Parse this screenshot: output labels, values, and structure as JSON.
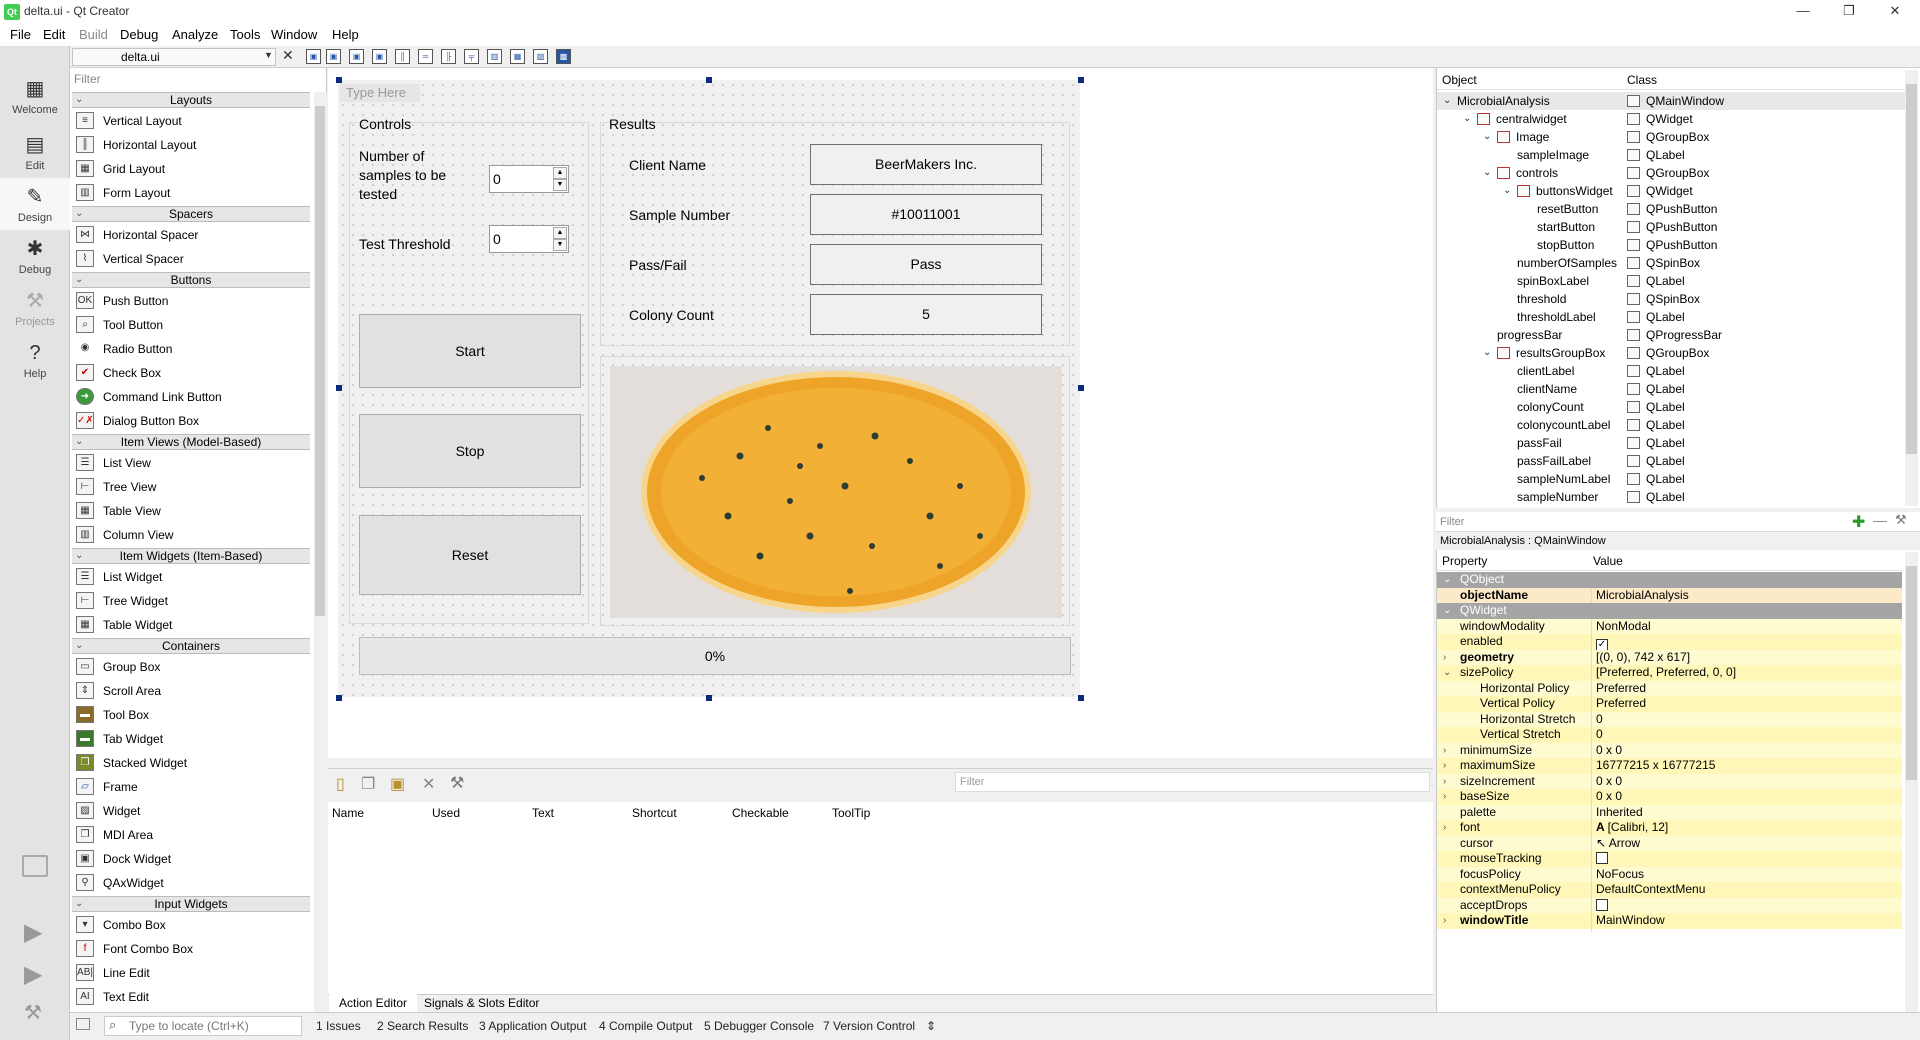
{
  "window": {
    "title": "delta.ui - Qt Creator",
    "logo": "qt",
    "min": "—",
    "restore": "❐",
    "close": "✕"
  },
  "menu": [
    "File",
    "Edit",
    "Build",
    "Debug",
    "Analyze",
    "Tools",
    "Window",
    "Help"
  ],
  "modes": [
    {
      "label": "Welcome",
      "icon": "grid-icon"
    },
    {
      "label": "Edit",
      "icon": "document-icon"
    },
    {
      "label": "Design",
      "icon": "pencil-icon"
    },
    {
      "label": "Debug",
      "icon": "bug-icon"
    },
    {
      "label": "Projects",
      "icon": "wrench-icon"
    },
    {
      "label": "Help",
      "icon": "help-icon"
    }
  ],
  "file_combo": {
    "value": "delta.ui"
  },
  "widget_box": {
    "filter_placeholder": "Filter",
    "categories": [
      "Layouts",
      "Spacers",
      "Buttons",
      "Item Views (Model-Based)",
      "Item Widgets (Item-Based)",
      "Containers",
      "Input Widgets"
    ],
    "items": [
      "Vertical Layout",
      "Horizontal Layout",
      "Grid Layout",
      "Form Layout",
      "Horizontal Spacer",
      "Vertical Spacer",
      "Push Button",
      "Tool Button",
      "Radio Button",
      "Check Box",
      "Command Link Button",
      "Dialog Button Box",
      "List View",
      "Tree View",
      "Table View",
      "Column View",
      "List Widget",
      "Tree Widget",
      "Table Widget",
      "Group Box",
      "Scroll Area",
      "Tool Box",
      "Tab Widget",
      "Stacked Widget",
      "Frame",
      "Widget",
      "MDI Area",
      "Dock Widget",
      "QAxWidget",
      "Combo Box",
      "Font Combo Box",
      "Line Edit",
      "Text Edit"
    ]
  },
  "form": {
    "type_here": "Type Here",
    "controls_title": "Controls",
    "samples_label": "Number of samples to be tested",
    "samples_value": "0",
    "threshold_label": "Test Threshold",
    "threshold_value": "0",
    "start": "Start",
    "stop": "Stop",
    "reset": "Reset",
    "results_title": "Results",
    "client_label": "Client Name",
    "client_value": "BeerMakers Inc.",
    "sample_label": "Sample Number",
    "sample_value": "#10011001",
    "passfail_label": "Pass/Fail",
    "passfail_value": "Pass",
    "colony_label": "Colony Count",
    "colony_value": "5",
    "progress": "0%",
    "progress_fraction": 0
  },
  "action_editor": {
    "filter_placeholder": "Filter",
    "columns": [
      "Name",
      "Used",
      "Text",
      "Shortcut",
      "Checkable",
      "ToolTip"
    ],
    "tabs": [
      "Action Editor",
      "Signals & Slots Editor"
    ]
  },
  "object_inspector": {
    "headers": [
      "Object",
      "Class"
    ],
    "rows": [
      {
        "name": "MicrobialAnalysis",
        "cls": "QMainWindow"
      },
      {
        "name": "centralwidget",
        "cls": "QWidget"
      },
      {
        "name": "Image",
        "cls": "QGroupBox"
      },
      {
        "name": "sampleImage",
        "cls": "QLabel"
      },
      {
        "name": "controls",
        "cls": "QGroupBox"
      },
      {
        "name": "buttonsWidget",
        "cls": "QWidget"
      },
      {
        "name": "resetButton",
        "cls": "QPushButton"
      },
      {
        "name": "startButton",
        "cls": "QPushButton"
      },
      {
        "name": "stopButton",
        "cls": "QPushButton"
      },
      {
        "name": "numberOfSamples",
        "cls": "QSpinBox"
      },
      {
        "name": "spinBoxLabel",
        "cls": "QLabel"
      },
      {
        "name": "threshold",
        "cls": "QSpinBox"
      },
      {
        "name": "thresholdLabel",
        "cls": "QLabel"
      },
      {
        "name": "progressBar",
        "cls": "QProgressBar"
      },
      {
        "name": "resultsGroupBox",
        "cls": "QGroupBox"
      },
      {
        "name": "clientLabel",
        "cls": "QLabel"
      },
      {
        "name": "clientName",
        "cls": "QLabel"
      },
      {
        "name": "colonyCount",
        "cls": "QLabel"
      },
      {
        "name": "colonycountLabel",
        "cls": "QLabel"
      },
      {
        "name": "passFail",
        "cls": "QLabel"
      },
      {
        "name": "passFailLabel",
        "cls": "QLabel"
      },
      {
        "name": "sampleNumLabel",
        "cls": "QLabel"
      },
      {
        "name": "sampleNumber",
        "cls": "QLabel"
      }
    ]
  },
  "property_editor": {
    "filter_placeholder": "Filter",
    "title": "MicrobialAnalysis : QMainWindow",
    "headers": [
      "Property",
      "Value"
    ],
    "rows": [
      {
        "name": "QObject",
        "value": ""
      },
      {
        "name": "objectName",
        "value": "MicrobialAnalysis"
      },
      {
        "name": "QWidget",
        "value": ""
      },
      {
        "name": "windowModality",
        "value": "NonModal"
      },
      {
        "name": "enabled",
        "value": "✓"
      },
      {
        "name": "geometry",
        "value": "[(0, 0), 742 x 617]"
      },
      {
        "name": "sizePolicy",
        "value": "[Preferred, Preferred, 0, 0]"
      },
      {
        "name": "Horizontal Policy",
        "value": "Preferred"
      },
      {
        "name": "Vertical Policy",
        "value": "Preferred"
      },
      {
        "name": "Horizontal Stretch",
        "value": "0"
      },
      {
        "name": "Vertical Stretch",
        "value": "0"
      },
      {
        "name": "minimumSize",
        "value": "0 x 0"
      },
      {
        "name": "maximumSize",
        "value": "16777215 x 16777215"
      },
      {
        "name": "sizeIncrement",
        "value": "0 x 0"
      },
      {
        "name": "baseSize",
        "value": "0 x 0"
      },
      {
        "name": "palette",
        "value": "Inherited"
      },
      {
        "name": "font",
        "value": "[Calibri, 12]"
      },
      {
        "name": "cursor",
        "value": "Arrow"
      },
      {
        "name": "mouseTracking",
        "value": ""
      },
      {
        "name": "focusPolicy",
        "value": "NoFocus"
      },
      {
        "name": "contextMenuPolicy",
        "value": "DefaultContextMenu"
      },
      {
        "name": "acceptDrops",
        "value": ""
      },
      {
        "name": "windowTitle",
        "value": "MainWindow"
      }
    ]
  },
  "status": {
    "locator_placeholder": "Type to locate (Ctrl+K)",
    "items": [
      "1  Issues",
      "2  Search Results",
      "3  Application Output",
      "4  Compile Output",
      "5  Debugger Console",
      "7  Version Control"
    ]
  },
  "colors": {
    "accent": "#0a2a7a",
    "section": "#a5a5a5",
    "yellow": "#fff7b8",
    "orange": "#fbe9c8"
  }
}
